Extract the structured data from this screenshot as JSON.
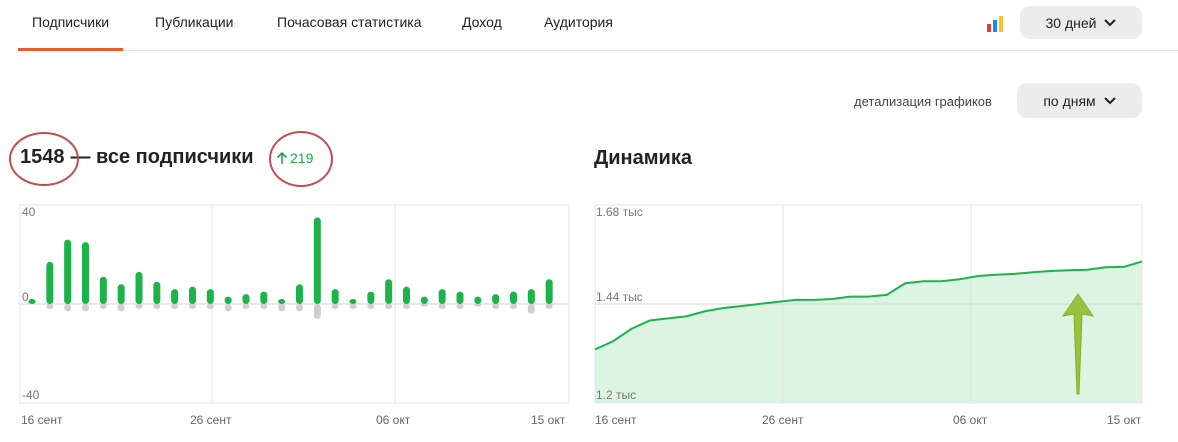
{
  "tabs": [
    {
      "label": "Подписчики",
      "active": true
    },
    {
      "label": "Публикации"
    },
    {
      "label": "Почасовая статистика"
    },
    {
      "label": "Доход"
    },
    {
      "label": "Аудитория"
    }
  ],
  "period_select": {
    "label": "30 дней"
  },
  "detail": {
    "label": "детализация графиков",
    "value": "по дням"
  },
  "left": {
    "count": "1548",
    "title": "— все подписчики",
    "growth": "219",
    "growth_color": "#1ea84a"
  },
  "right": {
    "title": "Динамика"
  },
  "chart_data": [
    {
      "type": "bar",
      "ylim": [
        -40,
        40
      ],
      "yticks": [
        "40",
        "0",
        "-40"
      ],
      "xticks": [
        "16 сент",
        "26 сент",
        "06 окт",
        "15 окт"
      ],
      "series": [
        {
          "values": [
            2,
            17,
            26,
            25,
            11,
            8,
            13,
            9,
            6,
            7,
            6,
            3,
            4,
            5,
            2,
            8,
            35,
            6,
            2,
            5,
            10,
            7,
            3,
            6,
            5,
            3,
            4,
            5,
            6,
            10
          ],
          "color": "#1db34a"
        },
        {
          "values": [
            0,
            -2,
            -3,
            -3,
            -2,
            -3,
            -2,
            -2,
            -2,
            -2,
            -2,
            -3,
            -2,
            -2,
            -3,
            -3,
            -6,
            -2,
            -2,
            -2,
            -2,
            -2,
            -1,
            -2,
            -2,
            -1,
            -2,
            -2,
            -4,
            -2
          ],
          "color": "#cfcfcf"
        }
      ]
    },
    {
      "type": "area",
      "ylim": [
        1200,
        1680
      ],
      "yticks": [
        "1.68 тыс",
        "1.44 тыс",
        "1.2 тыс"
      ],
      "xticks": [
        "16 сент",
        "26 сент",
        "06 окт",
        "15 окт"
      ],
      "series": [
        {
          "values": [
            1330,
            1350,
            1380,
            1400,
            1405,
            1410,
            1422,
            1430,
            1435,
            1440,
            1445,
            1450,
            1450,
            1452,
            1458,
            1458,
            1462,
            1490,
            1495,
            1495,
            1500,
            1508,
            1511,
            1513,
            1517,
            1520,
            1522,
            1523,
            1529,
            1530,
            1543
          ],
          "color": "#1db34a",
          "fill": "#dcf5e3"
        }
      ]
    }
  ]
}
